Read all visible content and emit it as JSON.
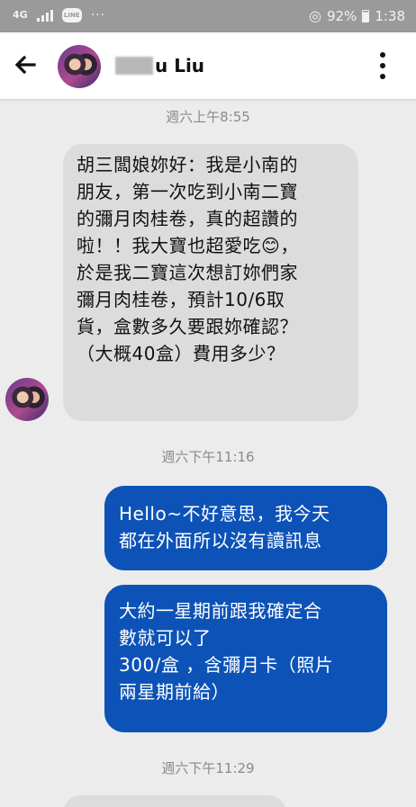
{
  "status_bar": {
    "network": "4G",
    "app_badge": "LINE",
    "more": "···",
    "battery": "92%",
    "time": "1:38"
  },
  "header": {
    "name_visible": "u Liu",
    "back_icon": "arrow-left-icon",
    "more_icon": "more-vertical-icon"
  },
  "messages": [
    {
      "timestamp": "週六上午8:55"
    },
    {
      "from": "contact",
      "text": "胡三闆娘妳好：我是小南的\n朋友，第一次吃到小南二寶\n的彌月肉桂卷，真的超讚的\n啦！！我大寶也超愛吃😊，\n於是我二寶這次想訂妳們家\n彌月肉桂卷，預計10/6取\n貨，盒數多久要跟妳確認？\n（大概40盒）費用多少？"
    },
    {
      "timestamp": "週六下午11:16"
    },
    {
      "from": "me",
      "text": "Hello~不好意思，我今天\n都在外面所以沒有讀訊息"
    },
    {
      "from": "me",
      "text": "大約一星期前跟我確定合\n數就可以了\n300/盒 ，含彌月卡（照片\n兩星期前給）"
    },
    {
      "timestamp": "週六下午11:29"
    }
  ],
  "colors": {
    "outgoing_bubble": "#0d53b7",
    "incoming_bubble": "#dcdcdc",
    "chat_background": "#ececec"
  }
}
